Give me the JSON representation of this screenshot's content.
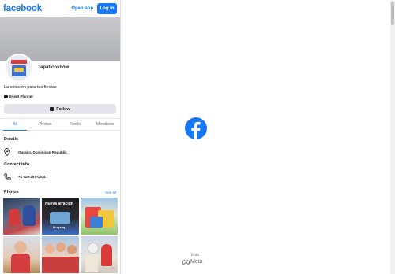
{
  "header": {
    "logo": "facebook",
    "open_app_label": "Open app",
    "login_label": "Log in"
  },
  "profile": {
    "name": "zapaticoshow",
    "bio": "La solución para tus fiestas",
    "category": "Event Planner",
    "follow_label": "Follow"
  },
  "tabs": [
    {
      "label": "All",
      "active": true
    },
    {
      "label": "Photos",
      "active": false
    },
    {
      "label": "Reels",
      "active": false
    },
    {
      "label": "Mentions",
      "active": false
    }
  ],
  "details": {
    "title": "Details",
    "location": "Gurabo, Dominican Republic"
  },
  "contact": {
    "title": "Contact info",
    "phone": "+1 829-297-0204"
  },
  "photos": {
    "title": "Photos",
    "see_all": "See all",
    "overlay_1": "Nueva atración",
    "overlay_2": "Mugsoq"
  },
  "splash": {
    "from_label": "from",
    "meta_label": "Meta"
  },
  "colors": {
    "brand": "#1877f2",
    "text": "#1c1e21",
    "secondary_text": "#65676b",
    "button_gray": "#e4e6eb"
  }
}
